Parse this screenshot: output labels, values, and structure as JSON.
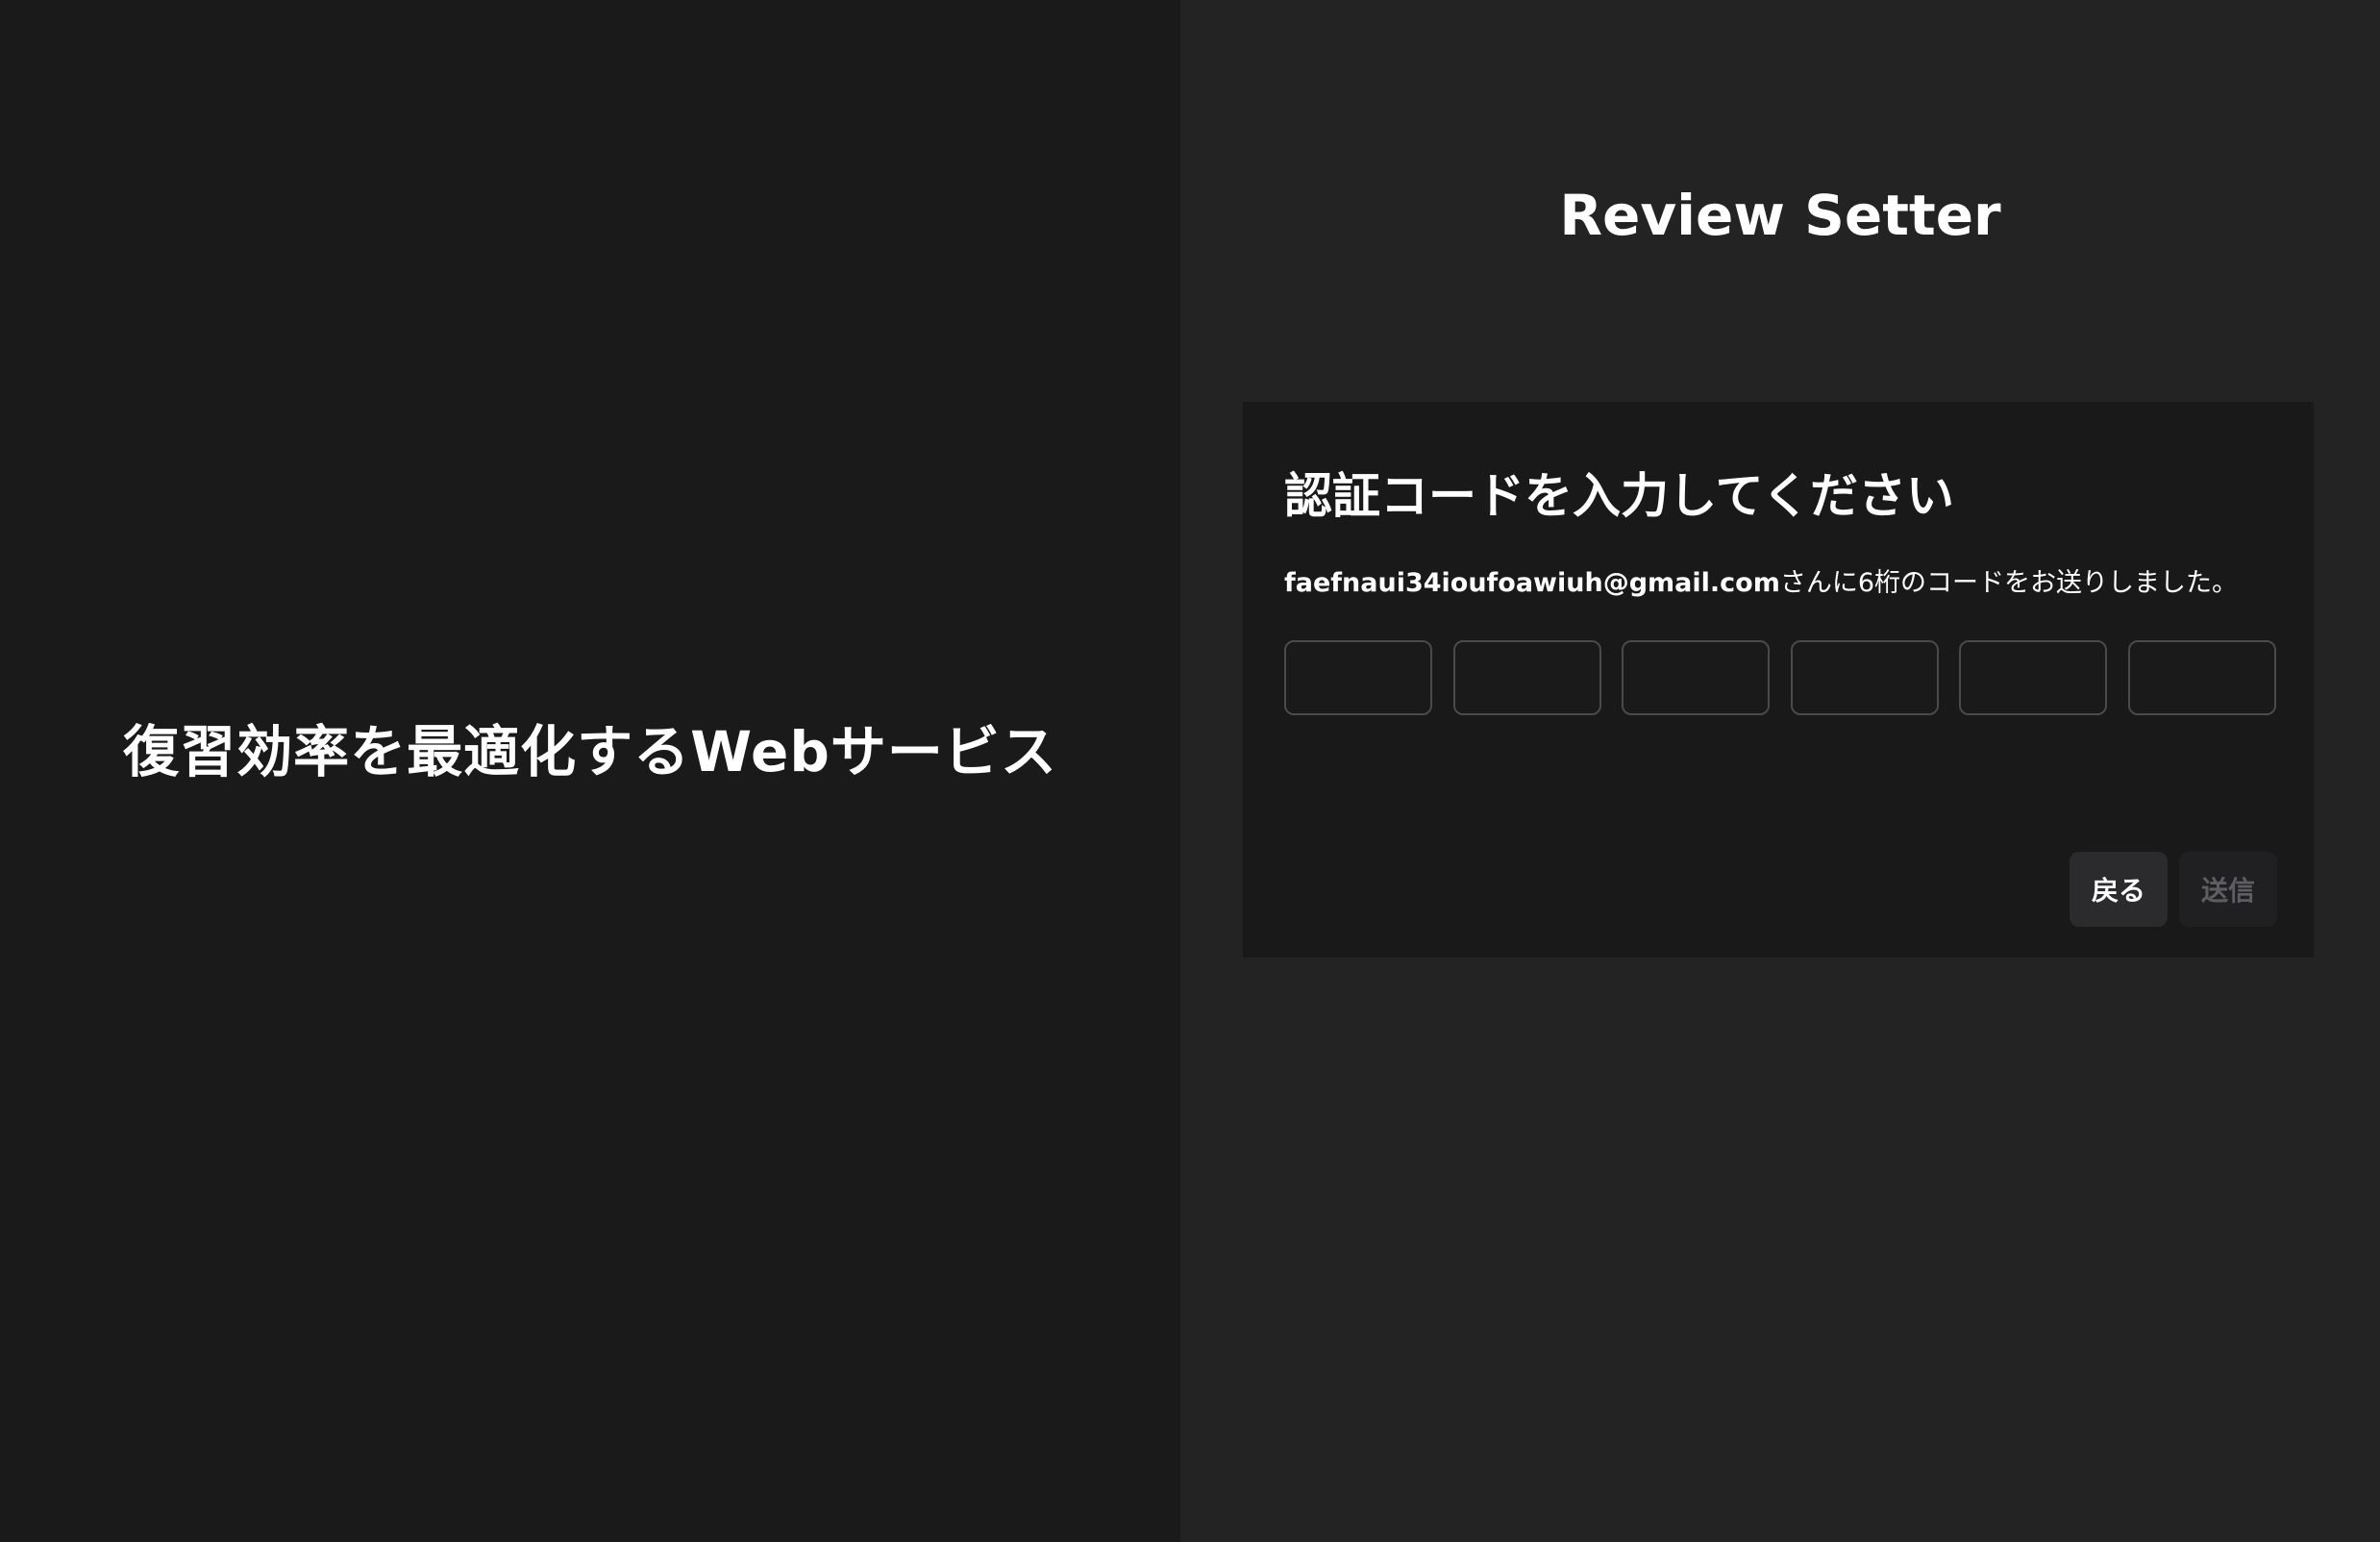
{
  "left": {
    "tagline": "復習効率を最適化するWebサービス"
  },
  "right": {
    "brand": "Review Setter"
  },
  "card": {
    "title": "認証コードを入力してください",
    "email": "faefnaui34ioufoawiuh@gmail.com",
    "description_suffix": "さんに6桁のコードをお送りしました。",
    "code_digits": [
      "",
      "",
      "",
      "",
      "",
      ""
    ],
    "back_label": "戻る",
    "send_label": "送信"
  }
}
